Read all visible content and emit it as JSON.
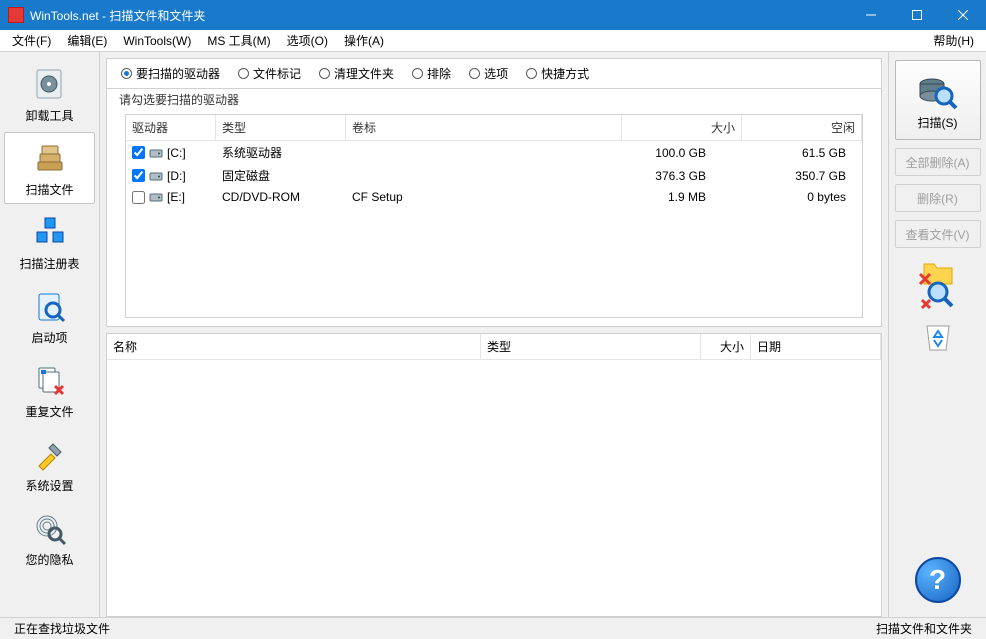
{
  "titlebar": {
    "title": "WinTools.net - 扫描文件和文件夹"
  },
  "menu": {
    "file": "文件(F)",
    "edit": "编辑(E)",
    "wintools": "WinTools(W)",
    "mstools": "MS 工具(M)",
    "options": "选项(O)",
    "actions": "操作(A)",
    "help": "帮助(H)"
  },
  "sidebar": {
    "uninstall": "卸载工具",
    "scanfiles": "扫描文件",
    "scanreg": "扫描注册表",
    "startup": "启动项",
    "dupfiles": "重复文件",
    "sysopt": "系统设置",
    "privacy": "您的隐私"
  },
  "tabs": {
    "drives": "要扫描的驱动器",
    "filemask": "文件标记",
    "cleanfolders": "清理文件夹",
    "exclude": "排除",
    "options": "选项",
    "shortcuts": "快捷方式"
  },
  "drive_group_label": "请勾选要扫描的驱动器",
  "drive_headers": {
    "drive": "驱动器",
    "type": "类型",
    "label": "卷标",
    "size": "大小",
    "free": "空闲"
  },
  "drives": [
    {
      "checked": true,
      "name": "[C:]",
      "type": "系统驱动器",
      "label": "",
      "size": "100.0 GB",
      "free": "61.5 GB"
    },
    {
      "checked": true,
      "name": "[D:]",
      "type": "固定磁盘",
      "label": "",
      "size": "376.3 GB",
      "free": "350.7 GB"
    },
    {
      "checked": false,
      "name": "[E:]",
      "type": "CD/DVD-ROM",
      "label": "CF Setup",
      "size": "1.9 MB",
      "free": "0 bytes"
    }
  ],
  "result_headers": {
    "name": "名称",
    "type": "类型",
    "size": "大小",
    "date": "日期"
  },
  "rightpanel": {
    "scan": "扫描(S)",
    "scan_u": "S",
    "delall": "全部删除(A)",
    "delall_u": "A",
    "delete": "删除(R)",
    "delete_u": "R",
    "view": "查看文件(V)",
    "view_u": "V"
  },
  "status": {
    "left": "正在查找垃圾文件",
    "right": "扫描文件和文件夹"
  }
}
